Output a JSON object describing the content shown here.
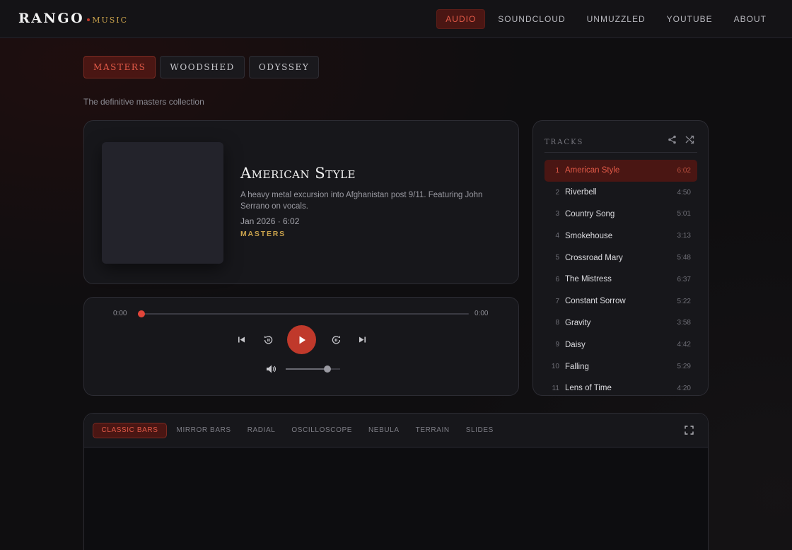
{
  "brand": {
    "name": "RANGO",
    "suffix": "MUSIC"
  },
  "nav": [
    {
      "label": "AUDIO",
      "active": true
    },
    {
      "label": "SOUNDCLOUD",
      "active": false
    },
    {
      "label": "UNMUZZLED",
      "active": false
    },
    {
      "label": "YOUTUBE",
      "active": false
    },
    {
      "label": "ABOUT",
      "active": false
    }
  ],
  "collections": [
    {
      "label": "MASTERS",
      "active": true
    },
    {
      "label": "WOODSHED",
      "active": false
    },
    {
      "label": "ODYSSEY",
      "active": false
    }
  ],
  "collection_description": "The definitive masters collection",
  "album": {
    "title": "American Style",
    "description": "A heavy metal excursion into Afghanistan post 9/11. Featuring John Serrano on vocals.",
    "meta": "Jan 2026 · 6:02",
    "tag": "MASTERS"
  },
  "player": {
    "current_time": "0:00",
    "total_time": "0:00",
    "progress": 0.01,
    "volume": 0.76
  },
  "tracks": {
    "title": "TRACKS",
    "items": [
      {
        "num": "1",
        "name": "American Style",
        "duration": "6:02",
        "active": true
      },
      {
        "num": "2",
        "name": "Riverbell",
        "duration": "4:50",
        "active": false
      },
      {
        "num": "3",
        "name": "Country Song",
        "duration": "5:01",
        "active": false
      },
      {
        "num": "4",
        "name": "Smokehouse",
        "duration": "3:13",
        "active": false
      },
      {
        "num": "5",
        "name": "Crossroad Mary",
        "duration": "5:48",
        "active": false
      },
      {
        "num": "6",
        "name": "The Mistress",
        "duration": "6:37",
        "active": false
      },
      {
        "num": "7",
        "name": "Constant Sorrow",
        "duration": "5:22",
        "active": false
      },
      {
        "num": "8",
        "name": "Gravity",
        "duration": "3:58",
        "active": false
      },
      {
        "num": "9",
        "name": "Daisy",
        "duration": "4:42",
        "active": false
      },
      {
        "num": "10",
        "name": "Falling",
        "duration": "5:29",
        "active": false
      },
      {
        "num": "11",
        "name": "Lens of Time",
        "duration": "4:20",
        "active": false
      }
    ]
  },
  "visualizer": {
    "modes": [
      {
        "label": "CLASSIC BARS",
        "active": true
      },
      {
        "label": "MIRROR BARS",
        "active": false
      },
      {
        "label": "RADIAL",
        "active": false
      },
      {
        "label": "OSCILLOSCOPE",
        "active": false
      },
      {
        "label": "NEBULA",
        "active": false
      },
      {
        "label": "TERRAIN",
        "active": false
      },
      {
        "label": "SLIDES",
        "active": false
      }
    ]
  },
  "colors": {
    "accent": "#c0392b",
    "accent_text": "#e35a48",
    "gold": "#c9a24c",
    "card": "#17171b"
  }
}
